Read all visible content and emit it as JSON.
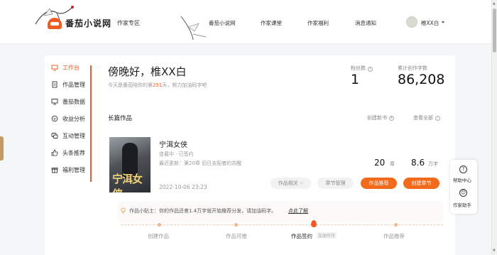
{
  "header": {
    "brand": "番茄小说网",
    "zone": "作家专区",
    "nav": [
      "番茄小说网",
      "作家课堂",
      "作家福利",
      "消息通知"
    ],
    "user_name": "椎XX白"
  },
  "sidebar": {
    "items": [
      {
        "label": "工作台",
        "icon": "desk-icon",
        "active": true
      },
      {
        "label": "作品管理",
        "icon": "document-icon"
      },
      {
        "label": "番茄数据",
        "icon": "monitor-icon"
      },
      {
        "label": "收益分析",
        "icon": "coin-icon"
      },
      {
        "label": "互动管理",
        "icon": "chat-icon"
      },
      {
        "label": "头条推荐",
        "icon": "thumb-up-icon"
      },
      {
        "label": "福利管理",
        "icon": "gift-icon"
      }
    ]
  },
  "greeting": {
    "title": "傍晚好，椎XX白",
    "sub_before": "今天是番茄陪你的第",
    "days": "251",
    "sub_after": "天，努力加油码字吧"
  },
  "stats": {
    "fans_label": "粉丝数",
    "fans_help": "?",
    "fans_value": "1",
    "words_label": "累计创作字数",
    "words_value": "86,208"
  },
  "section": {
    "title": "长篇作品",
    "create_link": "创建新书",
    "view_all_link": "查看全部"
  },
  "book": {
    "cover_text": "宁洱女侠",
    "title": "宁洱女侠",
    "status": "连载中 · 已签约",
    "latest": "最近更新：第20章 旧日支配者的苏醒",
    "date": "2022-10-06 23:23",
    "chapters": "20",
    "chapters_unit": "章",
    "words": "8.6",
    "words_unit": "万字",
    "btn_related": "作品相关",
    "btn_chapters": "章节管理",
    "btn_promote": "作品推荐",
    "btn_create": "创建章节"
  },
  "tip": {
    "text": "作品小贴士：你的作品还差1.4万字就开始推荐分发，请加油码字。",
    "link": "点此了解"
  },
  "progress": {
    "steps": [
      "创建作品",
      "作品可推",
      "作品签约",
      "作品推荐"
    ],
    "current_tag": "加油写作"
  },
  "helper": {
    "help_center": "帮助中心",
    "writer_assistant": "作家助手"
  },
  "colors": {
    "accent": "#f05a23",
    "button_orange": "#f26a1b"
  }
}
